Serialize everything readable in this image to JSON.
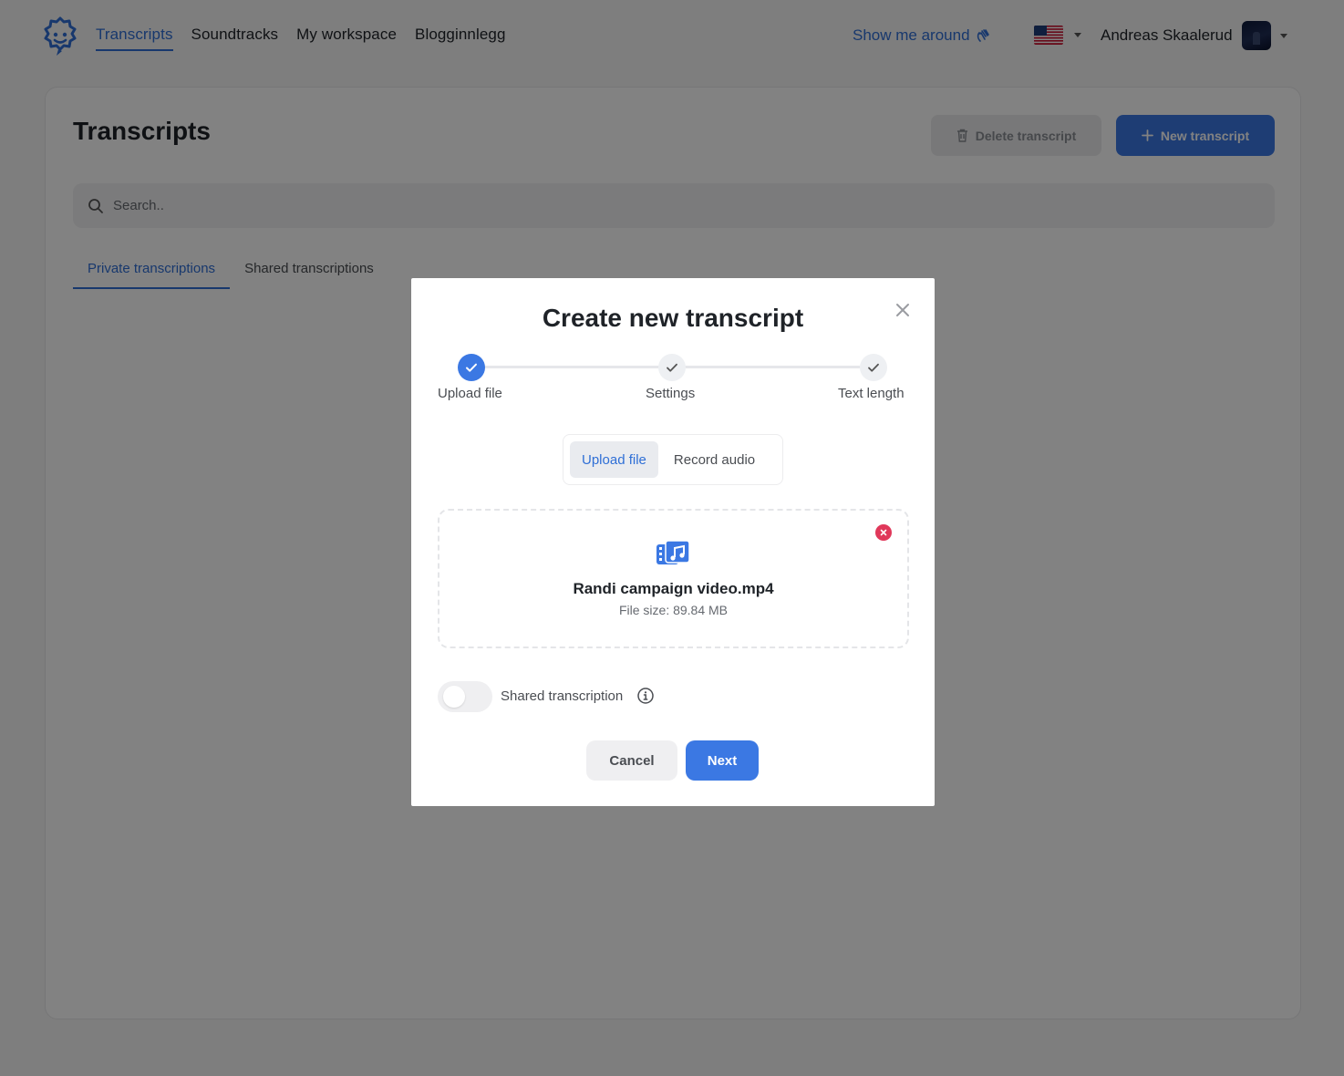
{
  "nav": {
    "links": [
      {
        "label": "Transcripts",
        "active": true
      },
      {
        "label": "Soundtracks",
        "active": false
      },
      {
        "label": "My workspace",
        "active": false
      },
      {
        "label": "Blogginnlegg",
        "active": false
      }
    ],
    "show_around": "Show me around",
    "show_around_icon": "waving-hand-icon",
    "language_flag": "us-flag-icon",
    "user_name": "Andreas Skaalerud"
  },
  "page": {
    "title": "Transcripts",
    "delete_button": "Delete transcript",
    "new_button": "New transcript",
    "search_placeholder": "Search..",
    "tabs": [
      {
        "label": "Private transcriptions",
        "active": true
      },
      {
        "label": "Shared transcriptions",
        "active": false
      }
    ]
  },
  "modal": {
    "title": "Create new transcript",
    "steps": [
      {
        "label": "Upload file",
        "state": "done"
      },
      {
        "label": "Settings",
        "state": "pending"
      },
      {
        "label": "Text length",
        "state": "pending"
      }
    ],
    "source_tabs": [
      {
        "label": "Upload file",
        "active": true
      },
      {
        "label": "Record audio",
        "active": false
      }
    ],
    "file": {
      "name": "Randi campaign video.mp4",
      "size": "File size: 89.84 MB"
    },
    "shared_toggle": {
      "label": "Shared transcription",
      "on": false
    },
    "cancel_button": "Cancel",
    "next_button": "Next"
  },
  "colors": {
    "accent": "#3b78e3",
    "remove": "#e0385a",
    "overlay": "rgba(0,0,0,0.49)"
  }
}
